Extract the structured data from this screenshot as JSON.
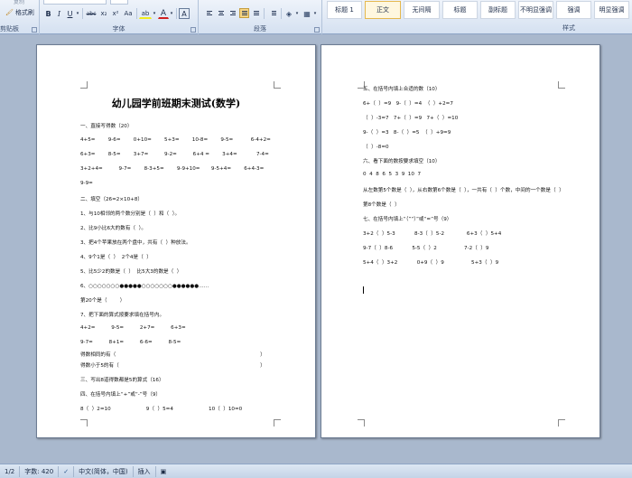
{
  "ribbon": {
    "clipboard": {
      "top_button": "复制",
      "format_painter": "格式刷",
      "label": "剪贴板"
    },
    "font": {
      "label": "字体",
      "bold": "B",
      "italic": "I",
      "underline": "U",
      "strike": "abc",
      "sub": "x₂",
      "sup": "x²",
      "clear": "Aa",
      "highlight": "ab",
      "font_color": "A",
      "char_border": "A"
    },
    "paragraph": {
      "label": "段落"
    },
    "styles": {
      "label": "样式",
      "items": [
        "标题 1",
        "正文",
        "无间隔",
        "标题",
        "副标题",
        "不明显强调",
        "强调",
        "明显强调"
      ]
    }
  },
  "page1": {
    "title": "幼儿园学前班期末测试(数学)",
    "lines": [
      "一、直接写得数（20）",
      "4+5=        9-6=        0+10=        5+3=        10-8=        9-5=           6-4+2=",
      "6+3=        8-5=        3+7=          9-2=          6+4 =        3+4=            7-4=",
      "3+2+4=          9-7=        8-3+5=        9-9+10=       9-5+4=        6+4-3=",
      "9-9=",
      "二、填空（26=2×10+8）",
      "1、与10相邻的两个数分别是（  ）和（  ）。",
      "2、比9小比6大的数有（  ）。",
      "3、把4个苹果放在两个盘中，共有（  ）种放法。",
      "4、9个1是（  ）  2个4是（  ）",
      "5、比5少2的数是（  ）  比5大3的数是（  ）",
      "6、○○○○○○○●●●●●○○○○○○○●●●●●●……",
      "第20个是（        ）",
      "7、把下面的算式按要求填在括号内。",
      "4+2=          9-5=          2+7=          6+3=",
      "9-7=          8+1=          6-6=          8-5=",
      "得数相同的有（                                                                                          ）",
      "得数小于5的有（                                                                                        ）",
      "三、写出8道得数都是5的算式（16）",
      "四、在括号内填上“+”或“-”号（9）",
      "8（  ）2=10                      9（  ）5=4                      10（  ）10=0"
    ]
  },
  "page2": {
    "lines": [
      "五、在括号内填上合适的数（10）",
      "6+（  ）=9   9-（  ）=4  （  ）+2=7",
      "（  ）-3=7   7+（  ）=9   7+（  ）=10",
      "9-（  ）=3   8-（  ）=5  （  ）+9=9",
      "（  ）-8=0",
      "六、看下面的数按要求填空（10）",
      "0  4  8  6  5  3  9  10  7",
      "从左数第5个数是（  ），从右数第6个数是（  ），一共有（  ）个数，中间的一个数是（  ）",
      "第8个数是（  ）",
      "七、在括号内填上“（”“）”或“=”号（9）",
      "3+2（  ）5-3            8-3（  ）5-2              6+3（  ）5+4",
      "9-7（  ）8-6            5-5（  ）2                 7-2（  ）9",
      "5+4（  ）3+2            0+9（  ）9                 5+3（  ）9"
    ]
  },
  "status": {
    "page": "1/2",
    "words": "字数: 420",
    "language": "中文(简体，中国)",
    "mode": "插入"
  }
}
